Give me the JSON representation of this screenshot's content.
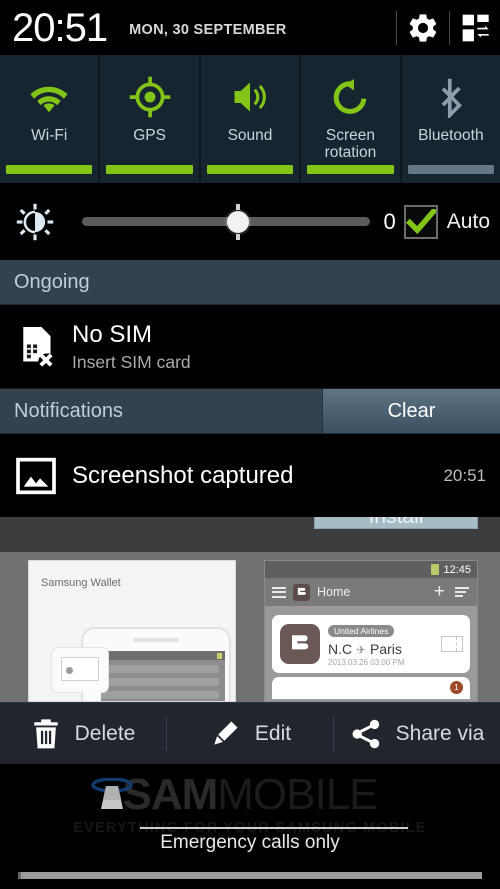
{
  "statusbar": {
    "time": "20:51",
    "date": "MON, 30 SEPTEMBER",
    "settings_icon": "gear-icon",
    "toggle_icon": "quick-toggle-grid-icon"
  },
  "quick_toggles": [
    {
      "label": "Wi-Fi",
      "icon": "wifi-icon",
      "active": true,
      "color": "#82c516"
    },
    {
      "label": "GPS",
      "icon": "gps-crosshair-icon",
      "active": true,
      "color": "#82c516"
    },
    {
      "label": "Sound",
      "icon": "speaker-icon",
      "active": true,
      "color": "#82c516"
    },
    {
      "label": "Screen\nrotation",
      "icon": "screen-rotation-icon",
      "active": true,
      "color": "#82c516"
    },
    {
      "label": "Bluetooth",
      "icon": "bluetooth-icon",
      "active": false,
      "color": "#647988"
    }
  ],
  "brightness": {
    "icon": "brightness-sun-icon",
    "value": "0",
    "auto_label": "Auto",
    "auto_checked": true,
    "thumb_percent": 49,
    "check_color": "#82c516"
  },
  "ongoing": {
    "header": "Ongoing",
    "items": [
      {
        "icon": "sim-card-error-icon",
        "title": "No SIM",
        "subtitle": "Insert SIM card"
      }
    ]
  },
  "notifications": {
    "header": "Notifications",
    "clear_label": "Clear",
    "items": [
      {
        "icon": "image-gallery-icon",
        "title": "Screenshot captured",
        "time": "20:51"
      }
    ]
  },
  "background_app": {
    "install_label": "Install",
    "screenshots": [
      {
        "name": "samsung-wallet-promo",
        "title": "Samsung Wallet"
      },
      {
        "name": "samsung-wallet-home",
        "status_time": "12:45",
        "action_title": "Home",
        "plus_label": "+",
        "pass": {
          "airline": "United Airlines",
          "origin": "N.C",
          "plane_glyph": "✈",
          "destination": "Paris",
          "datetime": "2013.03.26 03:00 PM"
        },
        "badge": "1"
      }
    ]
  },
  "action_bar": [
    {
      "label": "Delete",
      "icon": "trash-icon"
    },
    {
      "label": "Edit",
      "icon": "pencil-icon"
    },
    {
      "label": "Share via",
      "icon": "share-icon"
    }
  ],
  "watermark": {
    "logo_icon": "sammobile-logo-icon",
    "text_bold": "SAM",
    "text_light": "MOBILE",
    "tagline": "EVERYTHING FOR YOUR SAMSUNG MOBILE"
  },
  "lockscreen": {
    "emergency_text": "Emergency calls only"
  }
}
